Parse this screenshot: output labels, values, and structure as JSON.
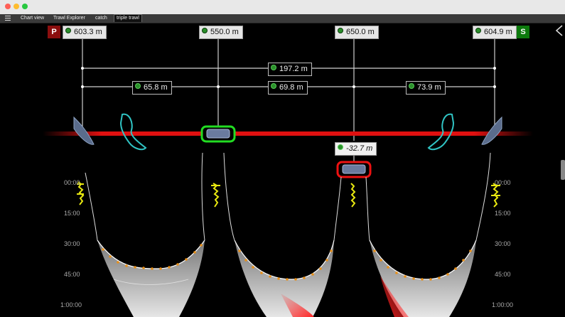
{
  "tabs": [
    {
      "label": "Chart view",
      "active": false
    },
    {
      "label": "Trawl Explorer",
      "active": false
    },
    {
      "label": "catch",
      "active": false
    },
    {
      "label": "triple trawl",
      "active": true
    }
  ],
  "sensors": {
    "port": {
      "tag": "P",
      "value": "603.3 m"
    },
    "left_clump": {
      "value": "550.0 m"
    },
    "right_clump": {
      "value": "650.0 m"
    },
    "starboard": {
      "tag": "S",
      "value": "604.9 m"
    }
  },
  "distances": {
    "total": "197.2 m",
    "left": "65.8 m",
    "center": "69.8 m",
    "right": "73.9 m",
    "height_diff": "-32.7 m"
  },
  "depth_axis": {
    "left": [
      "00:00",
      "15:00",
      "30:00",
      "45:00",
      "1:00:00"
    ],
    "right": [
      "00:00",
      "15:00",
      "30:00",
      "45:00",
      "1:00:00"
    ]
  },
  "colors": {
    "warp_line": "#e01010",
    "port_tag": "#8b0e0e",
    "starboard_tag": "#0c7a0c",
    "clump_ok": "#22dd22",
    "clump_alert": "#ee1111",
    "trawl_door": "#5a6c8c",
    "door_outline": "#30c4c4",
    "catch_sensor": "#e8e810"
  }
}
